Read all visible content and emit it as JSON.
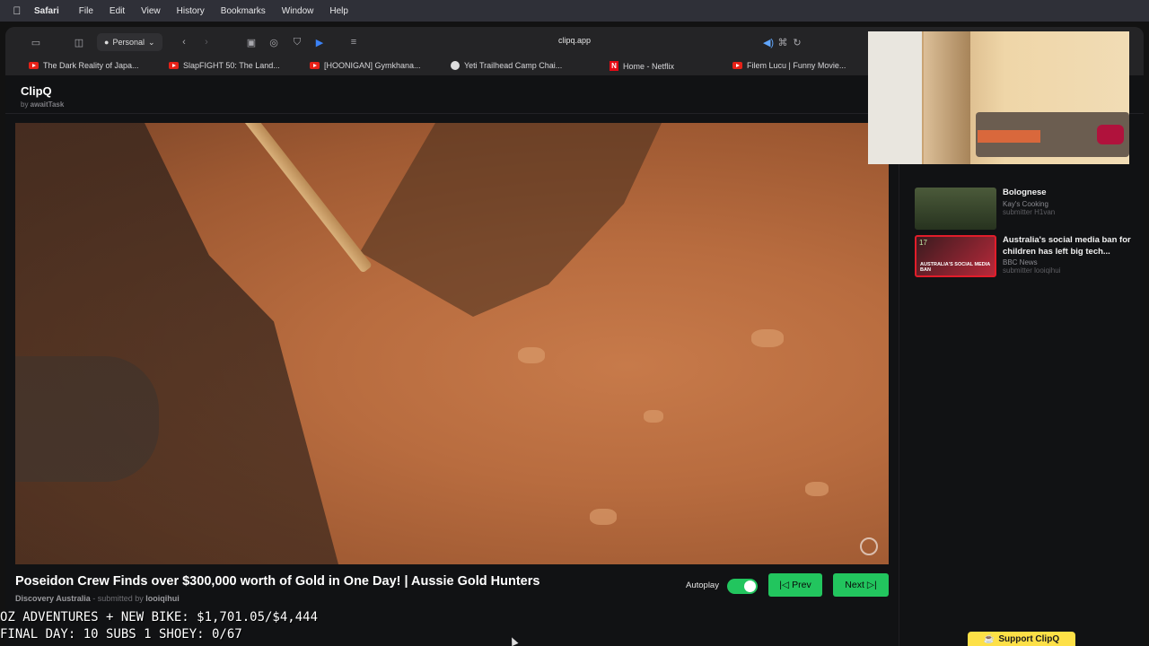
{
  "menubar": {
    "apple": "",
    "app": "Safari",
    "items": [
      "File",
      "Edit",
      "View",
      "History",
      "Bookmarks",
      "Window",
      "Help"
    ]
  },
  "toolbar": {
    "profile": "Personal",
    "url": "clipq.app"
  },
  "bookmarks": [
    {
      "label": "The Dark Reality of Japa...",
      "icon": "youtube-icon"
    },
    {
      "label": "SlapFIGHT 50: The Land...",
      "icon": "youtube-icon"
    },
    {
      "label": "[HOONIGAN] Gymkhana...",
      "icon": "youtube-icon"
    },
    {
      "label": "Yeti Trailhead Camp Chai...",
      "icon": "yeti-icon"
    },
    {
      "label": "Home - Netflix",
      "icon": "netflix-icon"
    },
    {
      "label": "Filem Lucu | Funny Movie...",
      "icon": "youtube-icon"
    }
  ],
  "site": {
    "logo": "ClipQ",
    "byline_prefix": "by ",
    "byline_author": "awaitTask"
  },
  "video": {
    "title": "Poseidon Crew Finds over $300,000 worth of Gold in One Day! | Aussie Gold Hunters",
    "channel": "Discovery Australia",
    "submitted_prefix": " - submitted by ",
    "submitter": "looiqihui"
  },
  "controls": {
    "autoplay_label": "Autoplay",
    "autoplay_on": true,
    "prev_label": "Prev",
    "next_label": "Next"
  },
  "queue": [
    {
      "rank": "",
      "title": "Bolognese",
      "channel": "Kay's Cooking",
      "submitter": "submitter H1van",
      "thumb_text": ""
    },
    {
      "rank": "17",
      "title": "Australia's social media ban for children has left big tech...",
      "channel": "BBC News",
      "submitter": "submitter looiqihui",
      "thumb_text": "AUSTRALIA'S SOCIAL MEDIA BAN"
    }
  ],
  "stream_overlay": {
    "line1": "OZ ADVENTURES + NEW BIKE: $1,701.05/$4,444",
    "line2": "FINAL DAY: 10 SUBS 1 SHOEY: 0/67"
  },
  "support_button": "Support ClipQ",
  "colors": {
    "accent_green": "#22c55e",
    "support_yellow": "#fde047",
    "background": "#111214"
  }
}
